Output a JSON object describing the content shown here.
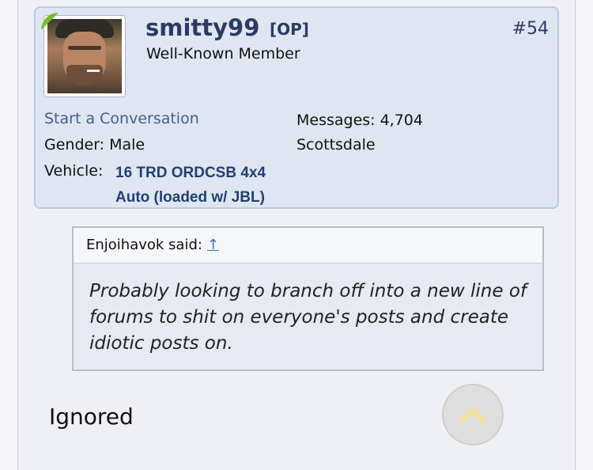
{
  "post": {
    "username": "smitty99",
    "op_badge": "[OP]",
    "post_number": "#54",
    "user_title": "Well-Known Member",
    "start_conversation": "Start a Conversation",
    "gender_label": "Gender:",
    "gender_value": "Male",
    "vehicle_label": "Vehicle:",
    "vehicle_line1": "16 TRD ORDCSB 4x4",
    "vehicle_line2": "Auto (loaded w/ JBL)",
    "messages_label": "Messages:",
    "messages_value": "4,704",
    "location": "Scottsdale"
  },
  "quote": {
    "author": "Enjoihavok said:",
    "arrow": "↑",
    "text": "Probably looking to branch off into a new line of forums to shit on everyone's posts and create idiotic posts on."
  },
  "ignored_label": "Ignored",
  "icons": {
    "scroll_top": "chevron-up-icon",
    "avatar": "avatar"
  },
  "colors": {
    "username": "#2c3a66",
    "card_bg": "#dfe6f2",
    "vehicle_text": "#1f3f74",
    "accent_green": "#7cbb2e"
  }
}
